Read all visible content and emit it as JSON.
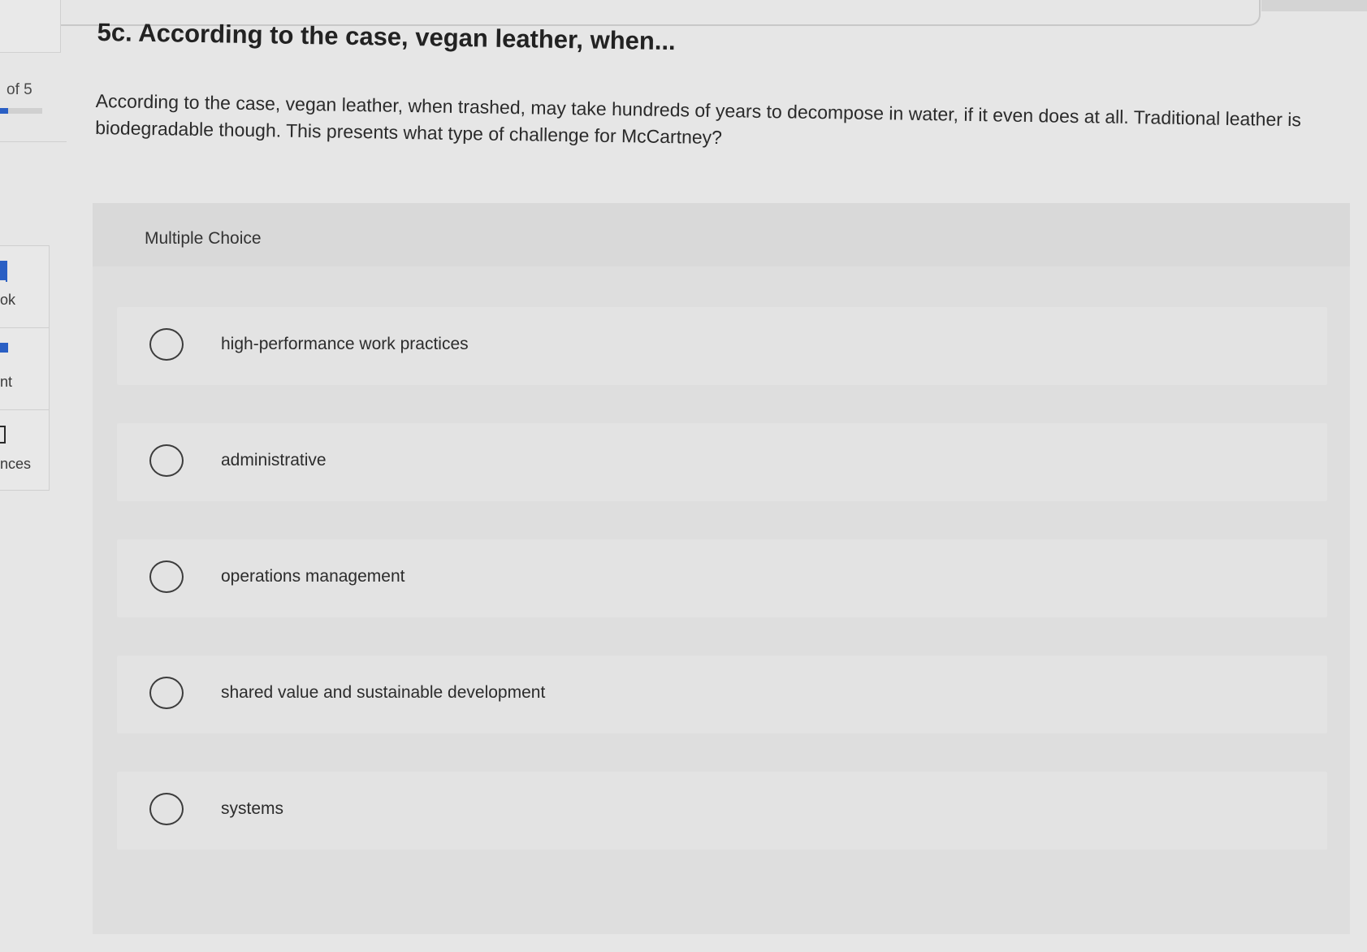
{
  "sidebar": {
    "progress_text": "of 5",
    "progress_fraction": 0.2,
    "items": [
      {
        "label": "ok"
      },
      {
        "label": "nt"
      },
      {
        "label": "nces"
      }
    ]
  },
  "question": {
    "title": "5c. According to the case, vegan leather, when...",
    "text": "According to the case, vegan leather, when trashed, may take hundreds of years to decompose in water, if it even does at all. Traditional leather is biodegradable though. This presents what type of challenge for McCartney?",
    "type_label": "Multiple Choice",
    "options": [
      {
        "label": "high-performance work practices",
        "selected": false
      },
      {
        "label": "administrative",
        "selected": false
      },
      {
        "label": "operations management",
        "selected": false
      },
      {
        "label": "shared value and sustainable development",
        "selected": false
      },
      {
        "label": "systems",
        "selected": false
      }
    ]
  },
  "colors": {
    "accent": "#2a5fc4",
    "background": "#e6e6e6"
  }
}
